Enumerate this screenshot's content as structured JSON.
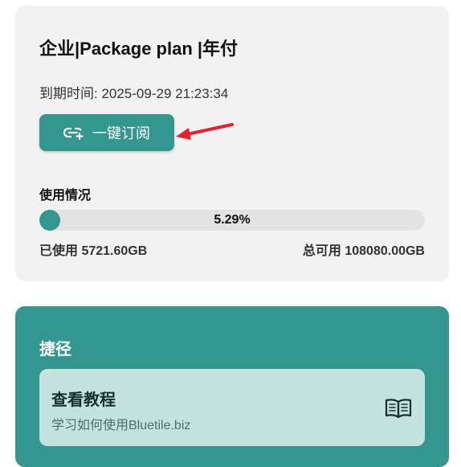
{
  "plan": {
    "title": "企业|Package plan |年付",
    "expire_label": "到期时间: 2025-09-29 21:23:34",
    "subscribe_label": "一键订阅",
    "usage_label": "使用情况",
    "usage_percent_text": "5.29%",
    "usage_fraction": 0.0529,
    "used_text": "已使用 5721.60GB",
    "total_text": "总可用 108080.00GB"
  },
  "shortcuts": {
    "title": "捷径",
    "tutorial_title": "查看教程",
    "tutorial_subtitle": "学习如何使用Bluetile.biz"
  },
  "icons": {
    "subscribe": "link-plus-icon",
    "tutorial": "book-open-icon",
    "annotation": "red-arrow"
  },
  "colors": {
    "accent": "#33968f",
    "card_bg": "#f2f2f2",
    "track_bg": "#e3e3e3",
    "tutorial_bg": "#c4e3de",
    "arrow": "#e8202a"
  }
}
